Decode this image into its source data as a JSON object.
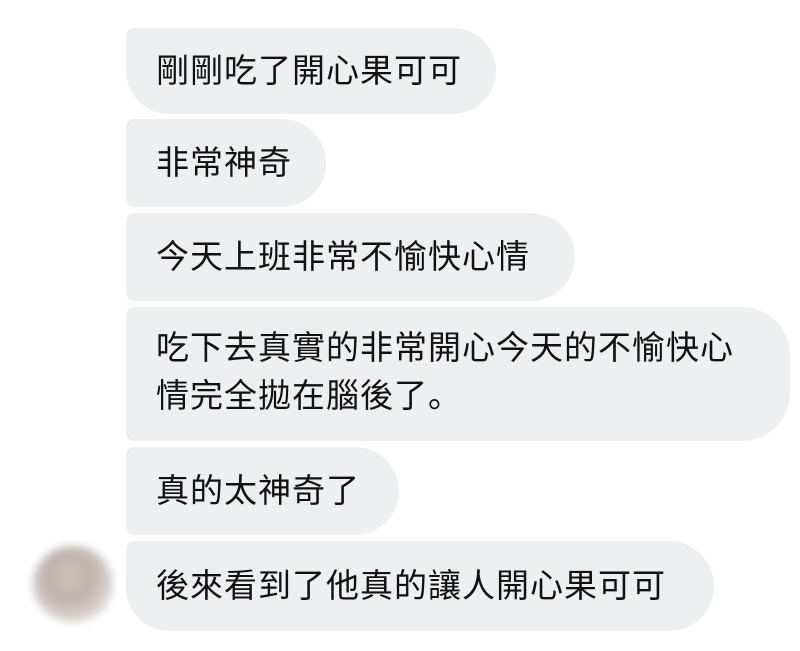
{
  "conversation": {
    "messages": [
      {
        "text": "剛剛吃了開心果可可"
      },
      {
        "text": "非常神奇"
      },
      {
        "text": "今天上班非常不愉快心情"
      },
      {
        "text": "吃下去真實的非常開心今天的不愉快心情完全拋在腦後了。"
      },
      {
        "text": "真的太神奇了"
      },
      {
        "text": "後來看到了他真的讓人開心果可可"
      }
    ]
  },
  "colors": {
    "bubble_background": "#eeeff1",
    "text": "#111111",
    "page_background": "#ffffff"
  }
}
